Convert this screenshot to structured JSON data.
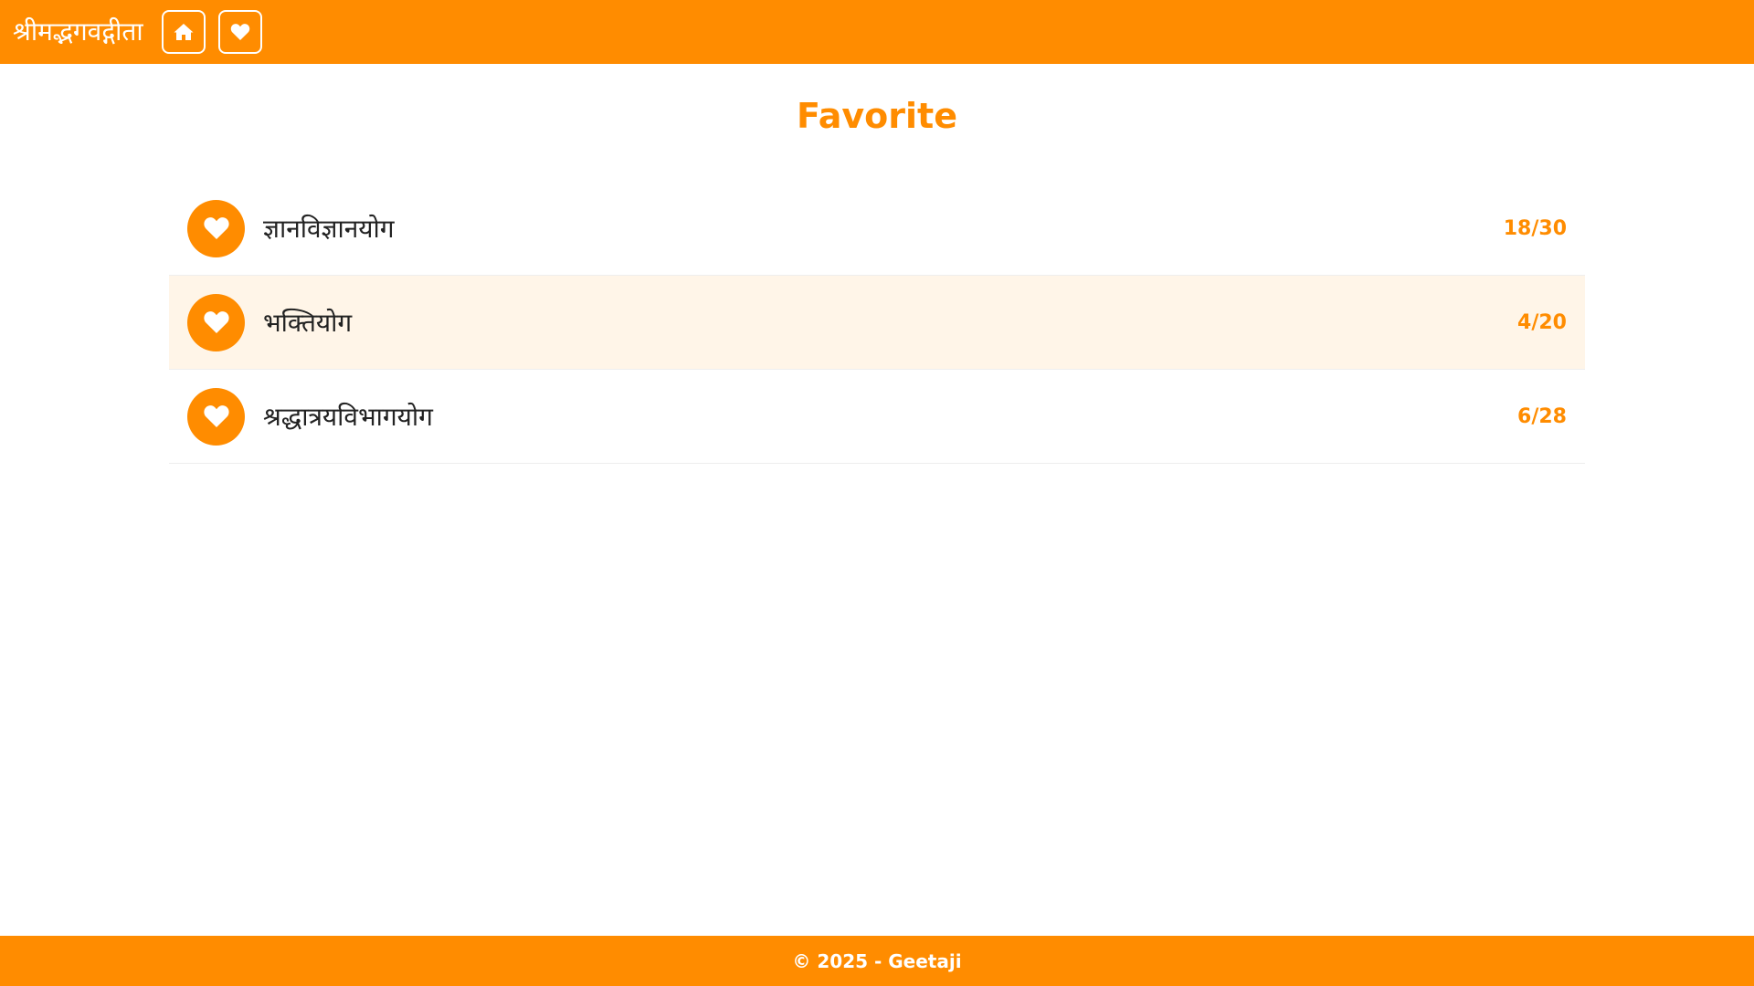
{
  "header": {
    "brand": "श्रीमद्भगवद्गीता",
    "home_icon": "home-icon",
    "favorites_icon": "heart-icon"
  },
  "page": {
    "title": "Favorite"
  },
  "favorites": [
    {
      "name": "ज्ञानविज्ञानयोग",
      "count": "18/30"
    },
    {
      "name": "भक्तियोग",
      "count": "4/20"
    },
    {
      "name": "श्रद्धात्रयविभागयोग",
      "count": "6/28"
    }
  ],
  "footer": {
    "text": "© 2025 - Geetaji"
  },
  "colors": {
    "accent": "#ff8c00",
    "highlight_row": "#fff5e8"
  }
}
